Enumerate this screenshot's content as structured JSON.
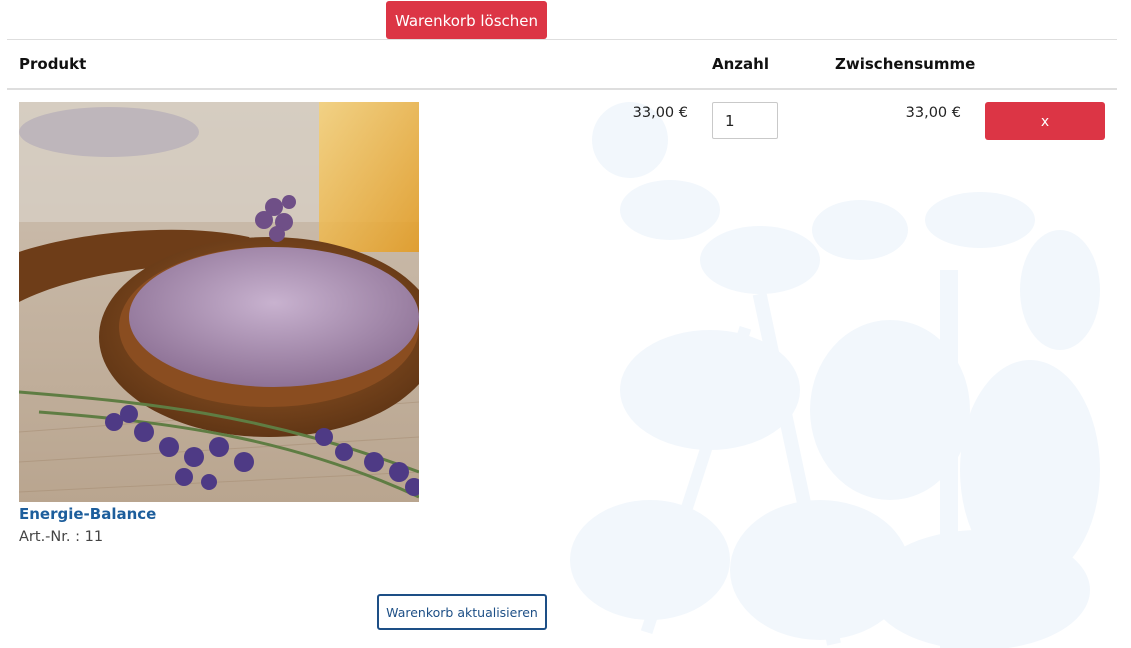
{
  "cart": {
    "clear_button": "Warenkorb löschen",
    "update_button": "Warenkorb aktualisieren",
    "columns": {
      "product": "Produkt",
      "quantity": "Anzahl",
      "subtotal": "Zwischensumme"
    },
    "items": [
      {
        "name": "Energie-Balance",
        "article": "Art.-Nr. : 11",
        "price": "33,00 €",
        "quantity": "1",
        "subtotal": "33,00 €",
        "remove_label": "x",
        "image_icon": "lavender-bath-salt-photo"
      }
    ]
  },
  "colors": {
    "danger": "#dc3545",
    "link": "#1d5e9c",
    "outline": "#1d4f86",
    "watermark": "#f3f8fc"
  }
}
